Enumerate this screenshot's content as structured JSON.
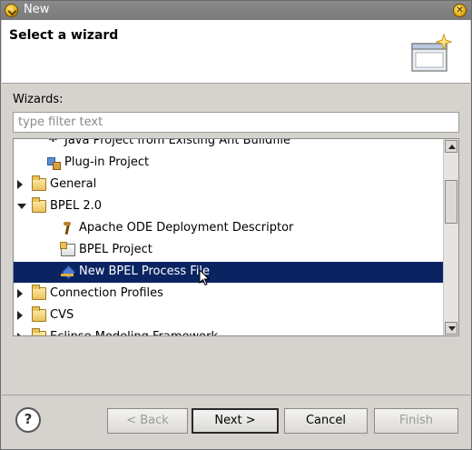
{
  "window": {
    "title": "New"
  },
  "header": {
    "heading": "Select a wizard"
  },
  "wizards_label": "Wizards:",
  "filter": {
    "placeholder": "type filter text",
    "value": ""
  },
  "tree": {
    "items": [
      {
        "label": "Java Project from Existing Ant Buildfile",
        "icon": "ant-icon",
        "indent": 1,
        "expander": "none"
      },
      {
        "label": "Plug-in Project",
        "icon": "plugin-icon",
        "indent": 1,
        "expander": "none"
      },
      {
        "label": "General",
        "icon": "folder-icon",
        "indent": 0,
        "expander": "collapsed"
      },
      {
        "label": "BPEL 2.0",
        "icon": "folder-icon",
        "indent": 0,
        "expander": "expanded"
      },
      {
        "label": "Apache ODE Deployment Descriptor",
        "icon": "descriptor-icon",
        "indent": 2,
        "expander": "none"
      },
      {
        "label": "BPEL Project",
        "icon": "project-icon",
        "indent": 2,
        "expander": "none"
      },
      {
        "label": "New BPEL Process File",
        "icon": "bpel-file-icon",
        "indent": 2,
        "expander": "none",
        "selected": true
      },
      {
        "label": "Connection Profiles",
        "icon": "folder-icon",
        "indent": 0,
        "expander": "collapsed"
      },
      {
        "label": "CVS",
        "icon": "folder-icon",
        "indent": 0,
        "expander": "collapsed"
      },
      {
        "label": "Eclipse Modeling Framework",
        "icon": "folder-icon",
        "indent": 0,
        "expander": "collapsed"
      }
    ]
  },
  "buttons": {
    "help": "?",
    "back": "< Back",
    "next": "Next >",
    "cancel": "Cancel",
    "finish": "Finish"
  },
  "colors": {
    "selection": "#0a2462",
    "titlebar": "#7e7e7e",
    "dialog_bg": "#d6d3ce"
  }
}
